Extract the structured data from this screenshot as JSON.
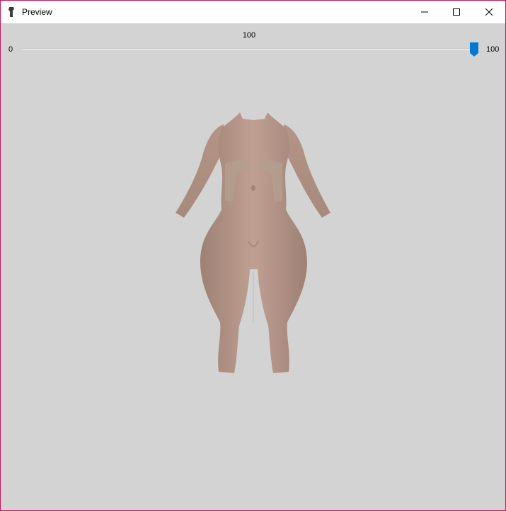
{
  "window": {
    "title": "Preview",
    "icon": "app-icon",
    "border_color": "#c2185b",
    "background_color": "#d3d3d3"
  },
  "caption_buttons": {
    "minimize_icon": "minimize-icon",
    "maximize_icon": "maximize-icon",
    "close_icon": "close-icon"
  },
  "slider": {
    "value_label": "100",
    "min_label": "0",
    "max_label": "100",
    "value": 100,
    "min": 0,
    "max": 100,
    "thumb_color": "#0078d7"
  },
  "preview": {
    "content": "3d-body-model",
    "skin_color": "#b8988a"
  }
}
